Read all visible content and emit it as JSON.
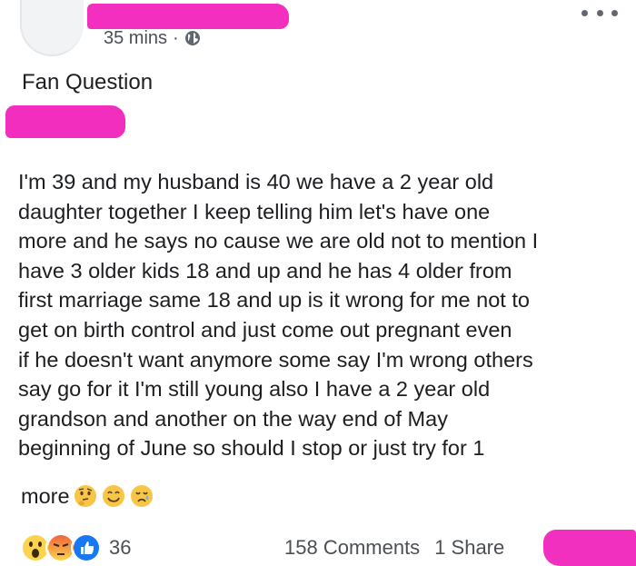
{
  "post": {
    "timestamp": "35 mins",
    "separator": "·",
    "privacy_icon": "globe-icon",
    "title": "Fan Question",
    "body": "I'm 39 and my husband is 40 we have a 2 year old\ndaughter together I keep telling him let's have one\nmore and he says no cause we are old not to mention I\nhave 3 older kids 18 and up and he has 4 older from\nfirst marriage same 18 and up is it wrong for me not to\nget on birth control and just come out pregnant even\nif he doesn't want anymore some say I'm wrong others\nsay go for it I'm still young also I have a 2 year old\ngrandson and another on the way end of May\nbeginning of June so should I stop or just try for 1",
    "body_tail": "more",
    "emojis": [
      "thinking-face-emoji",
      "smiling-face-emoji",
      "crying-face-emoji"
    ]
  },
  "footer": {
    "reaction_icons": [
      "wow-reaction-icon",
      "angry-reaction-icon",
      "like-reaction-icon"
    ],
    "reaction_count": "36",
    "comments": "158 Comments",
    "shares": "1 Share"
  },
  "colors": {
    "redaction": "#f230c0",
    "text": "#1c1e21",
    "meta_text": "#4b4f56",
    "like_blue": "#1877f2",
    "reaction_yellow": "#fcd34d",
    "angry_orange": "#f0643c"
  }
}
